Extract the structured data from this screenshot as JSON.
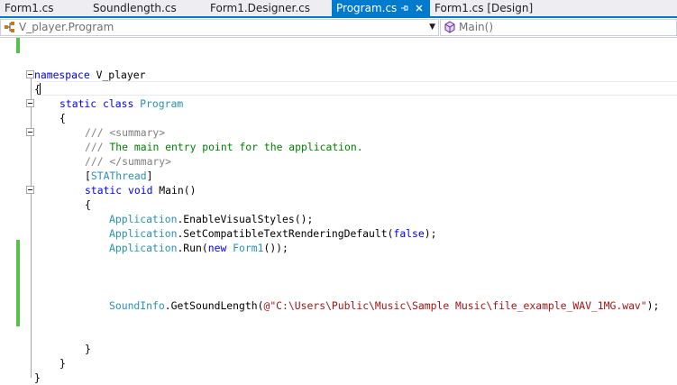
{
  "tabs": [
    {
      "label": "Form1.cs",
      "active": false
    },
    {
      "label": "Soundlength.cs",
      "active": false
    },
    {
      "label": "Form1.Designer.cs",
      "active": false
    },
    {
      "label": "Program.cs",
      "active": true
    },
    {
      "label": "Form1.cs [Design]",
      "active": false
    }
  ],
  "tab_icons": {
    "pin": "pin-icon",
    "close": "close-icon"
  },
  "navbar": {
    "type_selector": {
      "value": "V_player.Program",
      "icon": "class-icon"
    },
    "member_selector": {
      "value": "Main()",
      "icon": "method-icon"
    }
  },
  "colors": {
    "accent": "#007acc",
    "keyword": "#0000ff",
    "type": "#2b91af",
    "comment": "#008000",
    "string": "#a31515",
    "change_marker": "#57c14a"
  },
  "code": {
    "l1": {
      "kw": "namespace",
      "rest": " V_player"
    },
    "l2": "{",
    "l3": {
      "kw1": "static",
      "kw2": "class",
      "type": "Program"
    },
    "l4": "{",
    "l5": {
      "xml": "/// <summary>"
    },
    "l6": {
      "prefix": "///",
      "text": " The main entry point for the application."
    },
    "l7": {
      "xml": "/// </summary>"
    },
    "l8": {
      "open": "[",
      "type": "STAThread",
      "close": "]"
    },
    "l9": {
      "kw1": "static",
      "kw2": "void",
      "rest": " Main()"
    },
    "l10": "{",
    "l11": {
      "type": "Application",
      "rest": ".EnableVisualStyles();"
    },
    "l12": {
      "type": "Application",
      "rest": ".SetCompatibleTextRenderingDefault(",
      "kw": "false",
      "end": ");"
    },
    "l13": {
      "type": "Application",
      "rest": ".Run(",
      "kw": "new",
      "type2": "Form1",
      "end": "());"
    },
    "l14": {
      "type": "SoundInfo",
      "rest": ".GetSoundLength(",
      "str": "@\"C:\\Users\\Public\\Music\\Sample Music\\file_example_WAV_1MG.wav\"",
      "end": ");"
    },
    "l15": "}",
    "l16": "}",
    "l17": "}"
  }
}
